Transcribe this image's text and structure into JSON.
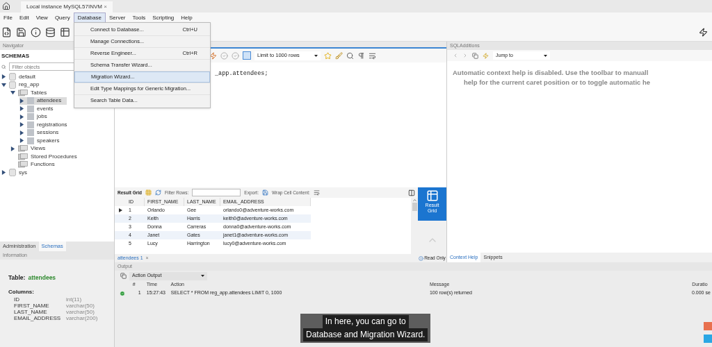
{
  "window_tab": {
    "title": "Local instance MySQL57INVM",
    "close": "×"
  },
  "menu_bar": [
    {
      "label": "File",
      "selected": false
    },
    {
      "label": "Edit",
      "selected": false
    },
    {
      "label": "View",
      "selected": false
    },
    {
      "label": "Query",
      "selected": false
    },
    {
      "label": "Database",
      "selected": true
    },
    {
      "label": "Server",
      "selected": false
    },
    {
      "label": "Tools",
      "selected": false
    },
    {
      "label": "Scripting",
      "selected": false
    },
    {
      "label": "Help",
      "selected": false
    }
  ],
  "database_menu": [
    {
      "label": "Connect to Database...",
      "shortcut": "Ctrl+U",
      "selected": false
    },
    {
      "label": "Manage Connections...",
      "selected": false
    },
    {
      "label": "Reverse Engineer...",
      "shortcut": "Ctrl+R",
      "selected": false
    },
    {
      "label": "Schema Transfer Wizard...",
      "selected": false
    },
    {
      "label": "Migration Wizard...",
      "selected": true
    },
    {
      "label": "Edit Type Mappings for Generic Migration...",
      "selected": false
    },
    {
      "label": "Search Table Data...",
      "selected": false
    }
  ],
  "navigator": {
    "title": "Navigator",
    "heading": "SCHEMAS",
    "filter_placeholder": "Filter objects",
    "tree": [
      {
        "label": "default",
        "kind": "schema",
        "expanded": false,
        "selected": false
      },
      {
        "label": "reg_app",
        "kind": "schema",
        "expanded": true,
        "selected": false,
        "children": [
          {
            "label": "Tables",
            "kind": "folder",
            "expanded": true,
            "selected": false,
            "children": [
              {
                "label": "attendees",
                "kind": "table",
                "expanded": false,
                "selected": true
              },
              {
                "label": "events",
                "kind": "table",
                "expanded": false,
                "selected": false
              },
              {
                "label": "jobs",
                "kind": "table",
                "expanded": false,
                "selected": false
              },
              {
                "label": "registrations",
                "kind": "table",
                "expanded": false,
                "selected": false
              },
              {
                "label": "sessions",
                "kind": "table",
                "expanded": false,
                "selected": false
              },
              {
                "label": "speakers",
                "kind": "table",
                "expanded": false,
                "selected": false
              }
            ]
          },
          {
            "label": "Views",
            "kind": "folder",
            "expanded": false,
            "selected": false
          },
          {
            "label": "Stored Procedures",
            "kind": "folder",
            "selected": false
          },
          {
            "label": "Functions",
            "kind": "folder",
            "selected": false
          }
        ]
      },
      {
        "label": "sys",
        "kind": "schema",
        "expanded": false,
        "selected": false
      }
    ],
    "tabs": [
      {
        "label": "Administration",
        "selected": false
      },
      {
        "label": "Schemas",
        "selected": true
      }
    ]
  },
  "information": {
    "title": "Information",
    "table_label": "Table:",
    "table_name": "attendees",
    "columns_label": "Columns:",
    "columns": [
      {
        "name": "ID",
        "type": "int(11)"
      },
      {
        "name": "FIRST_NAME",
        "type": "varchar(50)"
      },
      {
        "name": "LAST_NAME",
        "type": "varchar(50)"
      },
      {
        "name": "EMAIL_ADDRESS",
        "type": "varchar(200)"
      }
    ]
  },
  "editor": {
    "limit": "Limit to 1000 rows",
    "code_visible": "_app.attendees;"
  },
  "result": {
    "grid_label": "Result Grid",
    "filter_label": "Filter Rows:",
    "export_label": "Export:",
    "wrap_label": "Wrap Cell Content:",
    "columns": [
      "ID",
      "FIRST_NAME",
      "LAST_NAME",
      "EMAIL_ADDRESS"
    ],
    "rows": [
      {
        "cells": [
          "1",
          "Orlando",
          "Gee",
          "orlando0@adventure-works.com"
        ],
        "current": true
      },
      {
        "cells": [
          "2",
          "Keith",
          "Harris",
          "keith0@adventure-works.com"
        ],
        "current": false
      },
      {
        "cells": [
          "3",
          "Donna",
          "Carreras",
          "donna0@adventure-works.com"
        ],
        "current": false
      },
      {
        "cells": [
          "4",
          "Janet",
          "Gates",
          "janet1@adventure-works.com"
        ],
        "current": false
      },
      {
        "cells": [
          "5",
          "Lucy",
          "Harrington",
          "lucy0@adventure-works.com"
        ],
        "current": false
      }
    ],
    "side_button": "Result Grid",
    "read_only": "Read Only",
    "tab": "attendees 1",
    "tab_close": "×"
  },
  "sql_additions": {
    "title": "SQLAdditions",
    "jump_to": "Jump to",
    "help_lines": [
      "Automatic context help is disabled. Use the toolbar to manuall",
      "help for the current caret position or to toggle automatic he"
    ],
    "tabs": [
      {
        "label": "Context Help",
        "selected": true
      },
      {
        "label": "Snippets",
        "selected": false
      }
    ]
  },
  "output": {
    "title": "Output",
    "mode": "Action Output",
    "columns": [
      "#",
      "Time",
      "Action",
      "Message",
      "Duratio"
    ],
    "rows": [
      {
        "success": true,
        "number": "1",
        "time": "15:27:43",
        "action": "SELECT * FROM reg_app.attendees LIMIT 0, 1000",
        "message": "100 row(s) returned",
        "duration": "0.000 se"
      }
    ]
  },
  "subtitle": [
    "In here, you can go to",
    "Database and Migration Wizard."
  ]
}
